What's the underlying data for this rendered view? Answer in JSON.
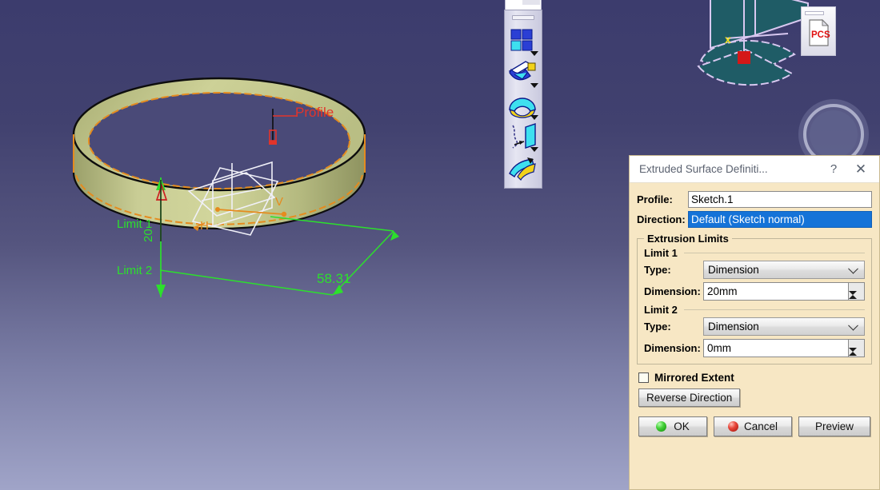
{
  "viewport": {
    "background_top": "#3c3c6d",
    "background_bottom": "#a0a4c8",
    "model": {
      "surface_color": "#b9bd86",
      "edge_color": "#e58b1f",
      "annotations": {
        "profile_label": "Profile",
        "limit1_label": "Limit 1",
        "limit2_label": "Limit 2",
        "limit1_value": "20",
        "diameter_value": "58.31",
        "axis_h": "H",
        "axis_v": "V"
      }
    }
  },
  "toolbar": {
    "name": "surfaces-toolbar",
    "buttons": [
      {
        "icon": "multi-sections-surface-icon",
        "has_dropdown": true
      },
      {
        "icon": "sweep-surface-icon",
        "has_dropdown": true
      },
      {
        "icon": "fill-surface-icon",
        "has_dropdown": true
      },
      {
        "icon": "extrude-surface-icon",
        "has_dropdown": true
      },
      {
        "icon": "blend-surface-icon",
        "has_dropdown": false
      }
    ]
  },
  "desktop": {
    "pcs_icon_label": "PCS",
    "compass_name": "navigation-compass"
  },
  "dialog": {
    "title": "Extruded Surface Definiti...",
    "help_label": "?",
    "close_label": "✕",
    "profile": {
      "label": "Profile:",
      "value": "Sketch.1"
    },
    "direction": {
      "label": "Direction:",
      "value": "Default (Sketch normal)",
      "selected": true,
      "highlight_color": "#1573d8"
    },
    "extrusion_limits": {
      "legend": "Extrusion Limits",
      "limit1": {
        "header": "Limit 1",
        "type_label": "Type:",
        "type_value": "Dimension",
        "dimension_label": "Dimension:",
        "dimension_value": "20mm"
      },
      "limit2": {
        "header": "Limit 2",
        "type_label": "Type:",
        "type_value": "Dimension",
        "dimension_label": "Dimension:",
        "dimension_value": "0mm"
      }
    },
    "mirrored_extent": {
      "label": "Mirrored Extent",
      "checked": false
    },
    "reverse_direction_label": "Reverse Direction",
    "buttons": {
      "ok": "OK",
      "cancel": "Cancel",
      "preview": "Preview"
    },
    "background_color": "#f7e7c4"
  }
}
